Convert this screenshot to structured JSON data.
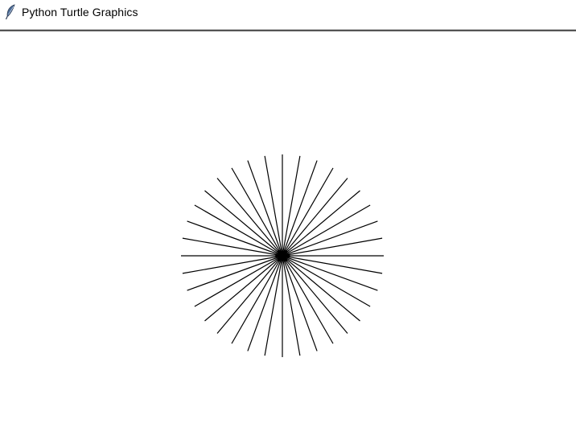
{
  "window": {
    "title": "Python Turtle Graphics",
    "icon": "feather-icon"
  },
  "canvas": {
    "background": "#ffffff",
    "drawing": {
      "shape": "starburst",
      "ray_count": 36,
      "ray_step_degrees": 10,
      "ray_color": "#000000",
      "turtle_color": "#000000",
      "turtle_icon": "turtle-cursor-icon"
    }
  }
}
